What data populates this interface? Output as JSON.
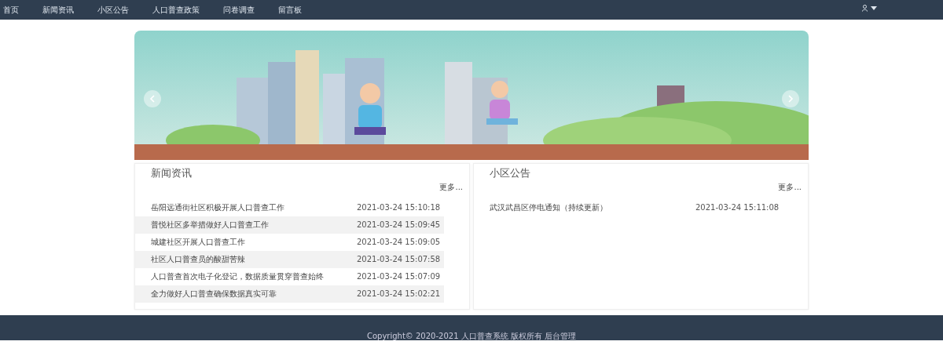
{
  "navbar": {
    "items": [
      {
        "label": "首页",
        "selected": false
      },
      {
        "label": "新闻资讯",
        "selected": false
      },
      {
        "label": "小区公告",
        "selected": false
      },
      {
        "label": "人口普查政策",
        "selected": false
      },
      {
        "label": "问卷调查",
        "selected": false
      },
      {
        "label": "留言板",
        "selected": false
      }
    ]
  },
  "panels": [
    {
      "title": "新闻资讯",
      "more": "更多...",
      "rows": [
        {
          "title": "岳阳远通街社区积极开展人口普查工作",
          "time": "2021-03-24 15:10:18"
        },
        {
          "title": "普悦社区多举措做好人口普查工作",
          "time": "2021-03-24 15:09:45"
        },
        {
          "title": "城建社区开展人口普查工作",
          "time": "2021-03-24 15:09:05"
        },
        {
          "title": "社区人口普查员的酸甜苦辣",
          "time": "2021-03-24 15:07:58"
        },
        {
          "title": "人口普查首次电子化登记，数据质量贯穿普查始终",
          "time": "2021-03-24 15:07:09"
        },
        {
          "title": "全力做好人口普查确保数据真实可靠",
          "time": "2021-03-24 15:02:21"
        }
      ]
    },
    {
      "title": "小区公告",
      "more": "更多...",
      "rows": [
        {
          "title": "武汉武昌区停电通知（持续更新）",
          "time": "2021-03-24 15:11:08"
        }
      ]
    }
  ],
  "footer": {
    "text": "Copyright© 2020-2021 人口普查系统 版权所有 后台管理"
  }
}
